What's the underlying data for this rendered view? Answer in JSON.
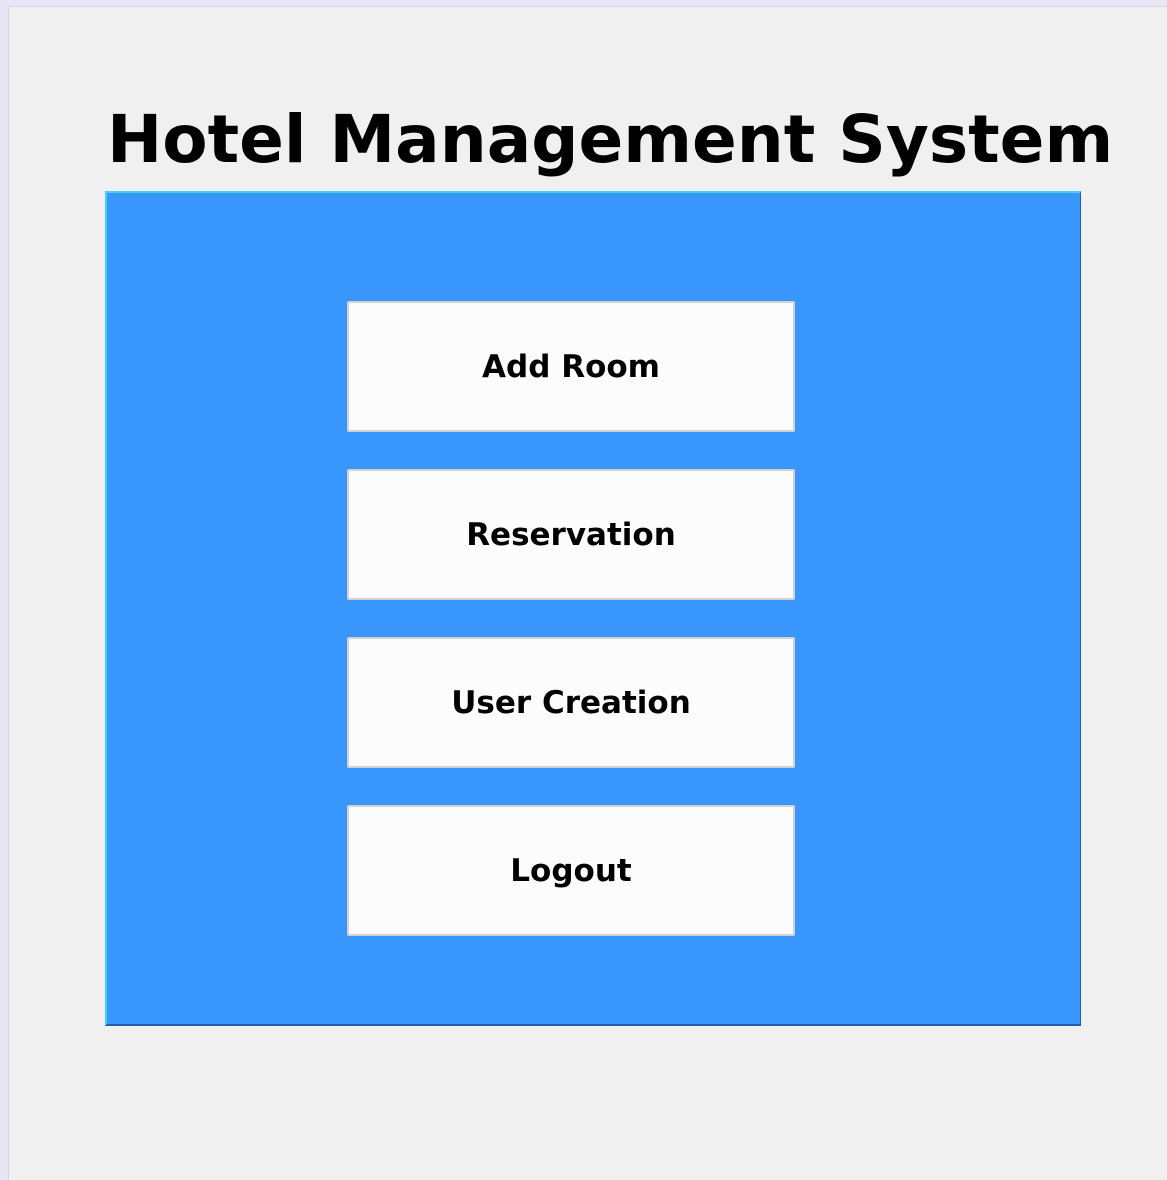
{
  "window": {
    "title": "Hotel Management System"
  },
  "menu": {
    "panel_color": "#3896fd",
    "buttons": [
      {
        "label": "Add Room"
      },
      {
        "label": "Reservation"
      },
      {
        "label": "User Creation"
      },
      {
        "label": "Logout"
      }
    ]
  }
}
